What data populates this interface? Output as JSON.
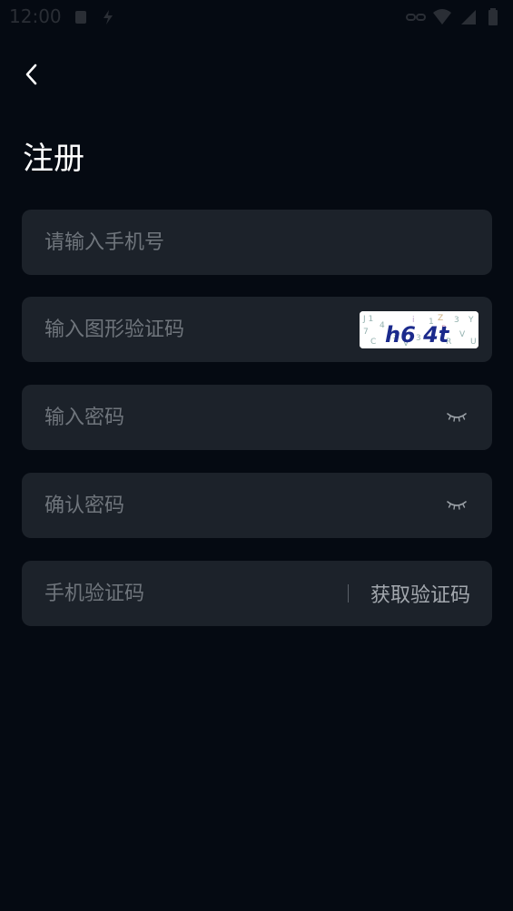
{
  "status_bar": {
    "time": "12:00"
  },
  "header": {
    "title": "注册",
    "back_icon": "chevron-left-icon"
  },
  "form": {
    "phone": {
      "placeholder": "请输入手机号",
      "value": ""
    },
    "captcha_input": {
      "placeholder": "输入图形验证码",
      "value": ""
    },
    "captcha_image_text": "h6 4t",
    "password": {
      "placeholder": "输入密码",
      "value": ""
    },
    "confirm_password": {
      "placeholder": "确认密码",
      "value": ""
    },
    "sms_code": {
      "placeholder": "手机验证码",
      "value": ""
    },
    "get_code_label": "获取验证码"
  },
  "colors": {
    "background": "#050a12",
    "field_background": "#1c222a",
    "placeholder": "#6f757c",
    "captcha_text": "#1b2a8c"
  }
}
